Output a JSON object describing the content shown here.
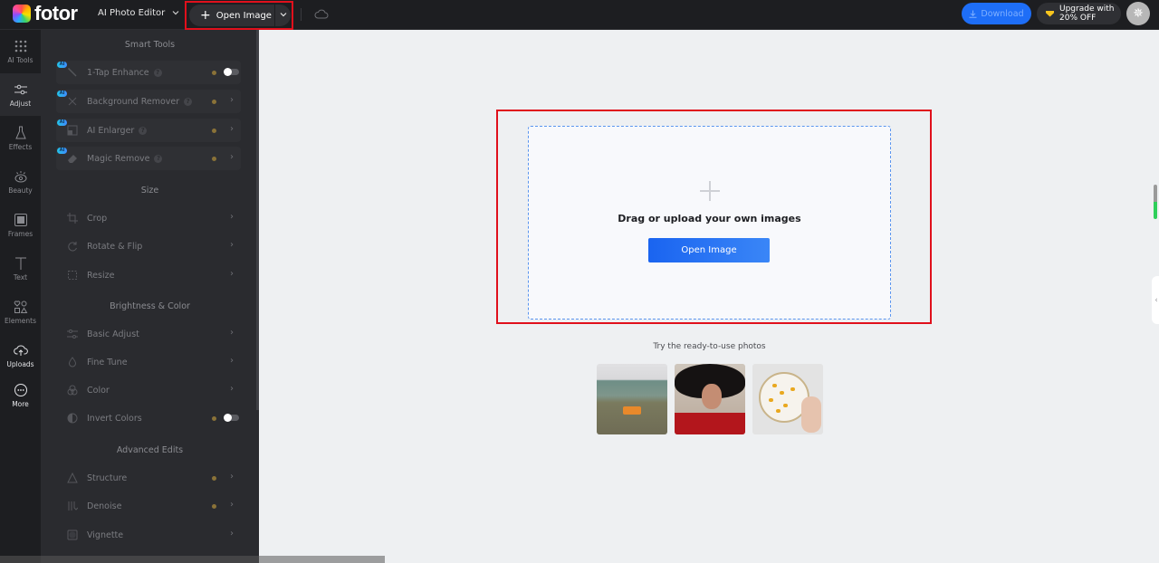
{
  "header": {
    "logo_text": "fotor",
    "app_switcher": "AI Photo Editor",
    "open_image": "Open Image",
    "download": "Download",
    "upgrade_line1": "Upgrade with",
    "upgrade_line2": "20% OFF"
  },
  "rail": [
    {
      "label": "AI Tools",
      "icon": "grid-dots-icon"
    },
    {
      "label": "Adjust",
      "icon": "sliders-icon"
    },
    {
      "label": "Effects",
      "icon": "flask-icon"
    },
    {
      "label": "Beauty",
      "icon": "eye-icon"
    },
    {
      "label": "Frames",
      "icon": "frame-icon"
    },
    {
      "label": "Text",
      "icon": "text-icon"
    },
    {
      "label": "Elements",
      "icon": "shapes-icon"
    },
    {
      "label": "Uploads",
      "icon": "cloud-upload-icon"
    },
    {
      "label": "More",
      "icon": "more-icon"
    }
  ],
  "panel": {
    "sections": [
      {
        "title": "Smart Tools"
      },
      {
        "title": "Size"
      },
      {
        "title": "Brightness & Color"
      },
      {
        "title": "Advanced Edits"
      }
    ],
    "smart_tools": [
      {
        "label": "1-Tap Enhance",
        "badge": "AI",
        "control": "toggle",
        "toggle_on": false
      },
      {
        "label": "Background Remover",
        "badge": "AI",
        "control": "chevron"
      },
      {
        "label": "AI Enlarger",
        "badge": "AI",
        "control": "chevron"
      },
      {
        "label": "Magic Remove",
        "badge": "AI",
        "control": "chevron"
      }
    ],
    "size_tools": [
      {
        "label": "Crop"
      },
      {
        "label": "Rotate & Flip"
      },
      {
        "label": "Resize"
      }
    ],
    "color_tools": [
      {
        "label": "Basic Adjust"
      },
      {
        "label": "Fine Tune"
      },
      {
        "label": "Color"
      },
      {
        "label": "Invert Colors",
        "control": "toggle",
        "toggle_on": false
      }
    ],
    "advanced_tools": [
      {
        "label": "Structure"
      },
      {
        "label": "Denoise"
      },
      {
        "label": "Vignette"
      }
    ]
  },
  "canvas": {
    "dropzone_text": "Drag or upload your own images",
    "open_button": "Open Image",
    "samples_label": "Try the ready-to-use photos",
    "samples": [
      {
        "name": "sample-photo-car-landscape"
      },
      {
        "name": "sample-photo-woman-hat"
      },
      {
        "name": "sample-photo-food-plate"
      }
    ]
  },
  "colors": {
    "accent": "#1e6ef7",
    "highlight_box": "#e0101c",
    "pro_dot": "#8a7238"
  }
}
